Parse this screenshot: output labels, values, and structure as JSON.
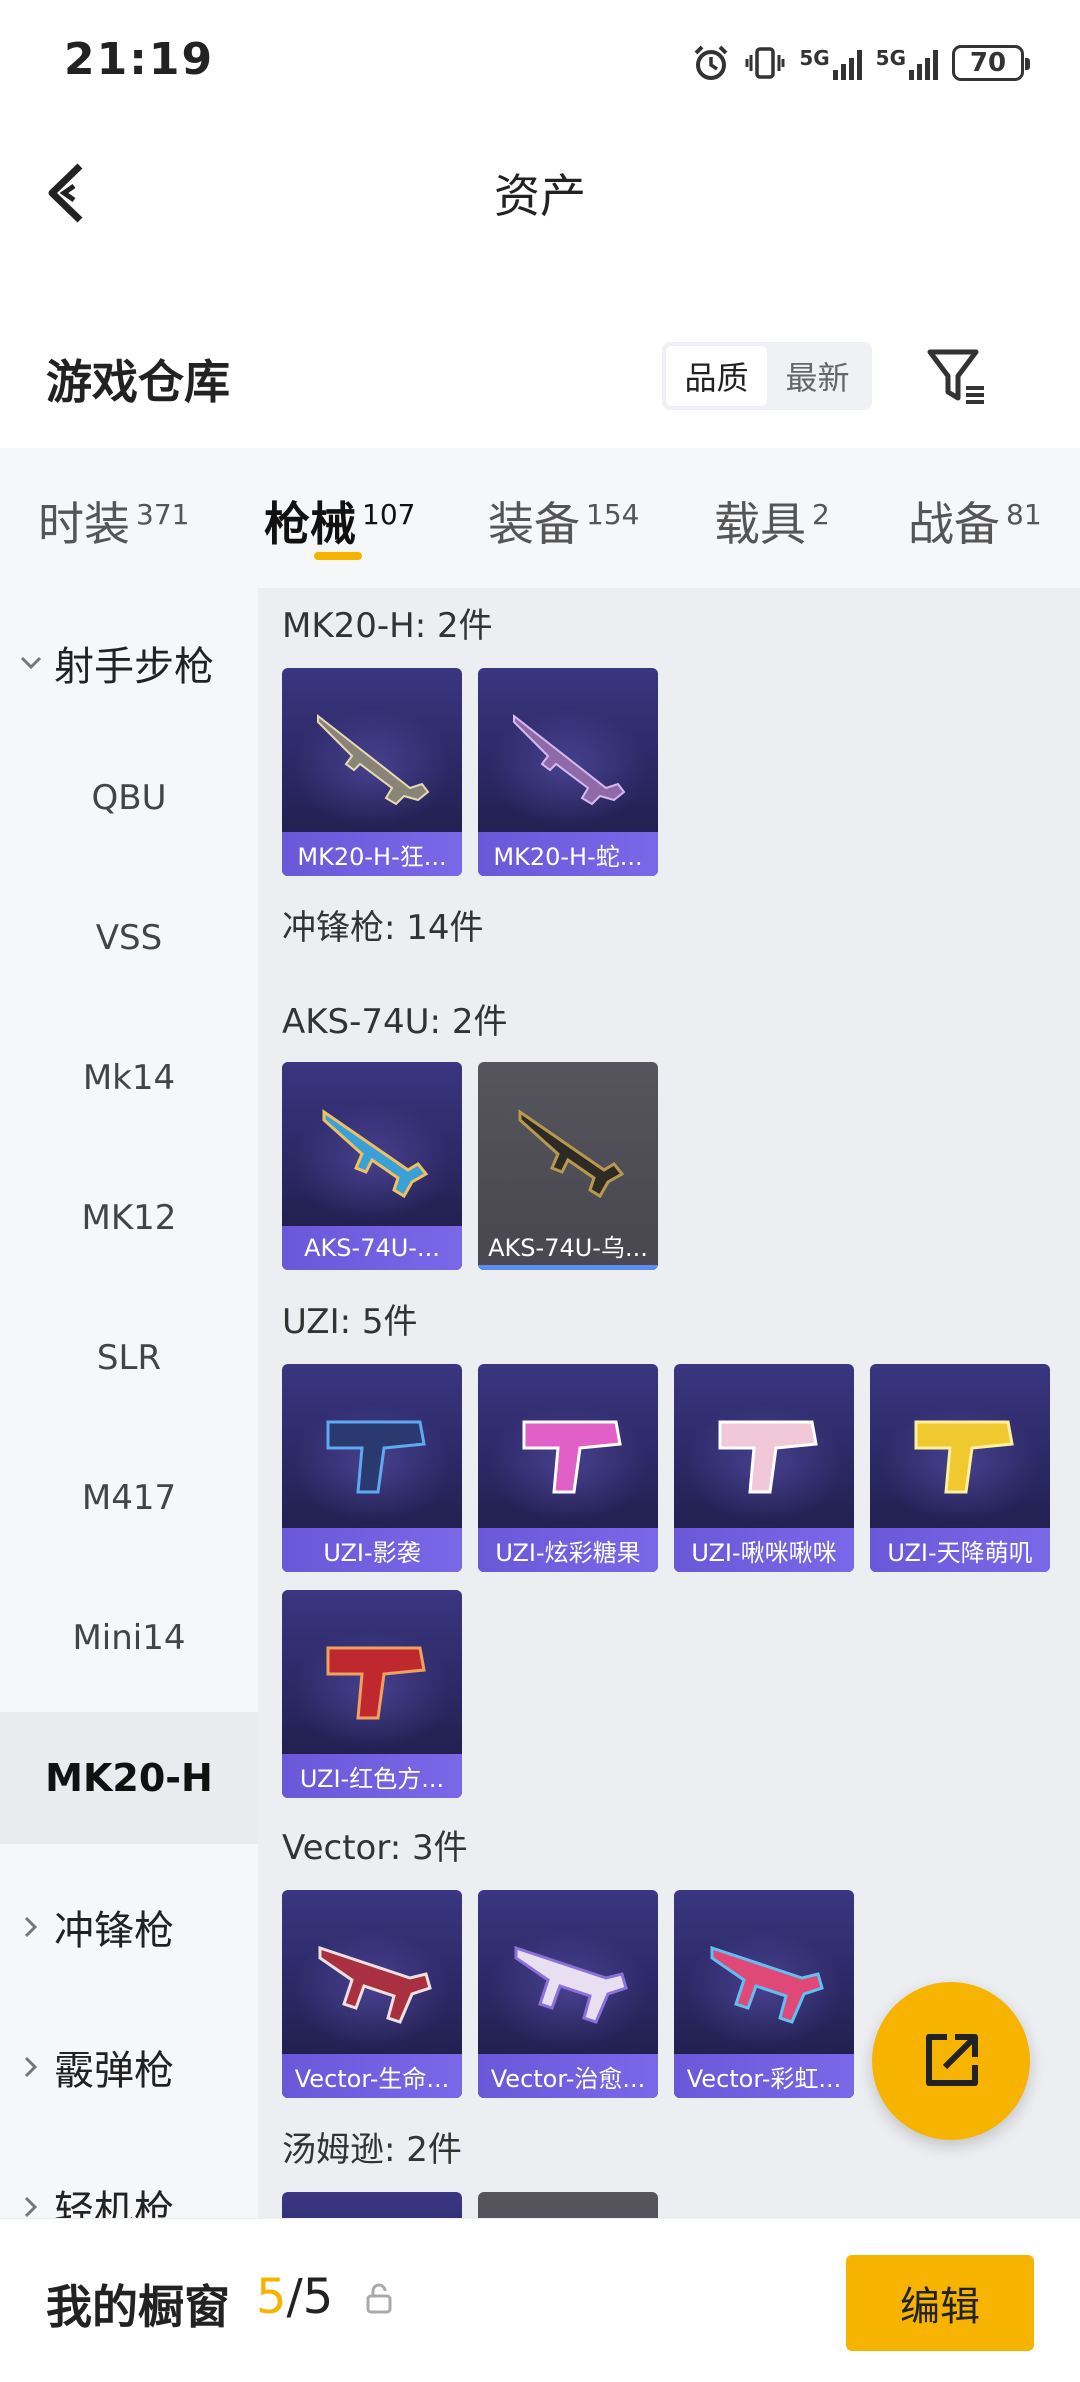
{
  "status": {
    "time": "21:19",
    "battery": "70",
    "net1": "5G",
    "net2": "5G"
  },
  "nav": {
    "title": "资产"
  },
  "warehouse": {
    "title": "游戏仓库",
    "sort_quality": "品质",
    "sort_newest": "最新"
  },
  "tabs": [
    {
      "label": "时装",
      "count": "371"
    },
    {
      "label": "枪械",
      "count": "107"
    },
    {
      "label": "装备",
      "count": "154"
    },
    {
      "label": "载具",
      "count": "2"
    },
    {
      "label": "战备",
      "count": "81"
    }
  ],
  "sidebar": {
    "category": "射手步枪",
    "items": [
      "QBU",
      "VSS",
      "Mk14",
      "MK12",
      "SLR",
      "M417",
      "Mini14"
    ],
    "selected": "MK20-H",
    "more": [
      "冲锋枪",
      "霰弹枪",
      "轻机枪"
    ]
  },
  "groups": [
    {
      "title": "MK20-H: 2件",
      "items": [
        "MK20-H-狂...",
        "MK20-H-蛇..."
      ]
    },
    {
      "title": "冲锋枪: 14件"
    },
    {
      "title": "AKS-74U: 2件",
      "items": [
        "AKS-74U-...",
        "AKS-74U-乌..."
      ]
    },
    {
      "title": "UZI: 5件",
      "items": [
        "UZI-影袭",
        "UZI-炫彩糖果",
        "UZI-啾咪啾咪",
        "UZI-天降萌叽",
        "UZI-红色方..."
      ]
    },
    {
      "title": "Vector: 3件",
      "items": [
        "Vector-生命...",
        "Vector-治愈...",
        "Vector-彩虹..."
      ]
    },
    {
      "title": "汤姆逊: 2件"
    }
  ],
  "bottom": {
    "label": "我的橱窗",
    "current": "5",
    "total": "/5",
    "edit": "编辑"
  },
  "colors": {
    "accent": "#f6b400",
    "card": "#2a2660",
    "card_label": "#6a58d8"
  },
  "icons": [
    "back-arrow-icon",
    "filter-icon",
    "chevron-down-icon",
    "chevron-right-icon",
    "share-icon",
    "lock-icon",
    "alarm-icon",
    "vibrate-icon",
    "signal-icon",
    "battery-icon"
  ]
}
